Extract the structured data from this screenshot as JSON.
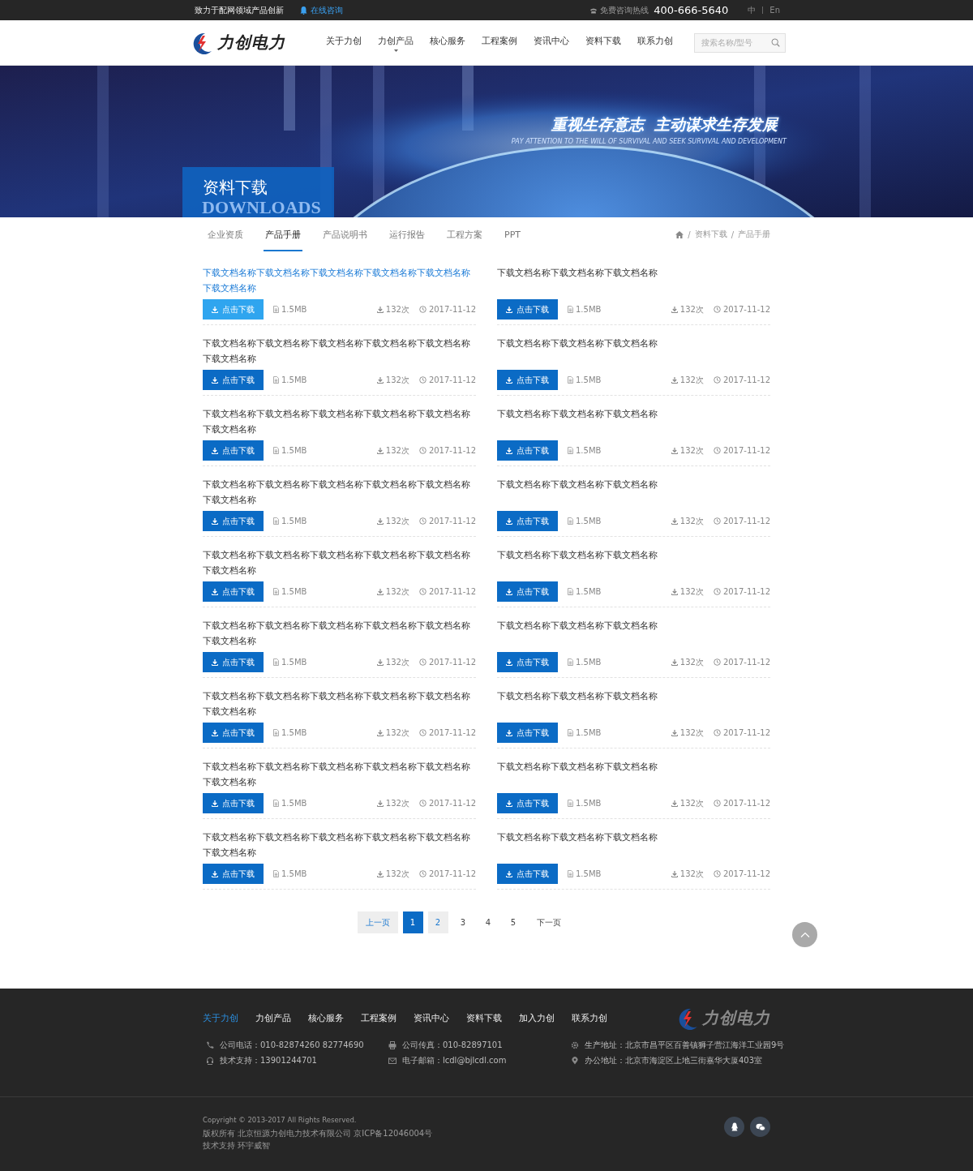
{
  "top_bar": {
    "slogan": "致力于配网领域产品创新",
    "consult_link": "在线咨询",
    "hotline_label": "免费咨询热线",
    "hotline": "400-666-5640",
    "languages": [
      "中",
      "En"
    ]
  },
  "header": {
    "logo_text": "力创电力",
    "nav": [
      {
        "label": "关于力创",
        "dropdown": false
      },
      {
        "label": "力创产品",
        "dropdown": true
      },
      {
        "label": "核心服务",
        "dropdown": false
      },
      {
        "label": "工程案例",
        "dropdown": false
      },
      {
        "label": "资讯中心",
        "dropdown": false
      },
      {
        "label": "资料下载",
        "dropdown": false
      },
      {
        "label": "联系力创",
        "dropdown": false
      }
    ],
    "search": {
      "placeholder": "搜索名称/型号"
    }
  },
  "banner": {
    "kind": "picture",
    "slogan": "重视生存意志  主动谋求生存发展",
    "slogan_en": "PAY ATTENTION TO THE WILL OF SURVIVAL AND SEEK SURVIVAL AND DEVELOPMENT",
    "section_title": "资料下载",
    "section_title_en": "DOWNLOADS"
  },
  "tabs": [
    {
      "label": "企业资质",
      "selected": false
    },
    {
      "label": "产品手册",
      "selected": true
    },
    {
      "label": "产品说明书",
      "selected": false
    },
    {
      "label": "运行报告",
      "selected": false
    },
    {
      "label": "工程方案",
      "selected": false
    },
    {
      "label": "PPT",
      "selected": false
    }
  ],
  "breadcrumb": [
    {
      "separator": "/",
      "label": "资料下载"
    },
    {
      "separator": "/",
      "label": "产品手册"
    }
  ],
  "documents": [
    {
      "title": "下载文档名称下载文档名称下载文档名称下载文档名称下载文档名称下载文档名称",
      "hovered": true,
      "button": "点击下载",
      "size": "1.5MB",
      "downloads": "132次",
      "date": "2017-11-12"
    },
    {
      "title": "下载文档名称下载文档名称下载文档名称",
      "hovered": false,
      "button": "点击下载",
      "size": "1.5MB",
      "downloads": "132次",
      "date": "2017-11-12"
    },
    {
      "title": "下载文档名称下载文档名称下载文档名称下载文档名称下载文档名称下载文档名称",
      "hovered": false,
      "button": "点击下载",
      "size": "1.5MB",
      "downloads": "132次",
      "date": "2017-11-12"
    },
    {
      "title": "下载文档名称下载文档名称下载文档名称",
      "hovered": false,
      "button": "点击下载",
      "size": "1.5MB",
      "downloads": "132次",
      "date": "2017-11-12"
    },
    {
      "title": "下载文档名称下载文档名称下载文档名称下载文档名称下载文档名称下载文档名称",
      "hovered": false,
      "button": "点击下载",
      "size": "1.5MB",
      "downloads": "132次",
      "date": "2017-11-12"
    },
    {
      "title": "下载文档名称下载文档名称下载文档名称",
      "hovered": false,
      "button": "点击下载",
      "size": "1.5MB",
      "downloads": "132次",
      "date": "2017-11-12"
    },
    {
      "title": "下载文档名称下载文档名称下载文档名称下载文档名称下载文档名称下载文档名称",
      "hovered": false,
      "button": "点击下载",
      "size": "1.5MB",
      "downloads": "132次",
      "date": "2017-11-12"
    },
    {
      "title": "下载文档名称下载文档名称下载文档名称",
      "hovered": false,
      "button": "点击下载",
      "size": "1.5MB",
      "downloads": "132次",
      "date": "2017-11-12"
    },
    {
      "title": "下载文档名称下载文档名称下载文档名称下载文档名称下载文档名称下载文档名称",
      "hovered": false,
      "button": "点击下载",
      "size": "1.5MB",
      "downloads": "132次",
      "date": "2017-11-12"
    },
    {
      "title": "下载文档名称下载文档名称下载文档名称",
      "hovered": false,
      "button": "点击下载",
      "size": "1.5MB",
      "downloads": "132次",
      "date": "2017-11-12"
    },
    {
      "title": "下载文档名称下载文档名称下载文档名称下载文档名称下载文档名称下载文档名称",
      "hovered": false,
      "button": "点击下载",
      "size": "1.5MB",
      "downloads": "132次",
      "date": "2017-11-12"
    },
    {
      "title": "下载文档名称下载文档名称下载文档名称",
      "hovered": false,
      "button": "点击下载",
      "size": "1.5MB",
      "downloads": "132次",
      "date": "2017-11-12"
    },
    {
      "title": "下载文档名称下载文档名称下载文档名称下载文档名称下载文档名称下载文档名称",
      "hovered": false,
      "button": "点击下载",
      "size": "1.5MB",
      "downloads": "132次",
      "date": "2017-11-12"
    },
    {
      "title": "下载文档名称下载文档名称下载文档名称",
      "hovered": false,
      "button": "点击下载",
      "size": "1.5MB",
      "downloads": "132次",
      "date": "2017-11-12"
    },
    {
      "title": "下载文档名称下载文档名称下载文档名称下载文档名称下载文档名称下载文档名称",
      "hovered": false,
      "button": "点击下载",
      "size": "1.5MB",
      "downloads": "132次",
      "date": "2017-11-12"
    },
    {
      "title": "下载文档名称下载文档名称下载文档名称",
      "hovered": false,
      "button": "点击下载",
      "size": "1.5MB",
      "downloads": "132次",
      "date": "2017-11-12"
    },
    {
      "title": "下载文档名称下载文档名称下载文档名称下载文档名称下载文档名称下载文档名称",
      "hovered": false,
      "button": "点击下载",
      "size": "1.5MB",
      "downloads": "132次",
      "date": "2017-11-12"
    },
    {
      "title": "下载文档名称下载文档名称下载文档名称",
      "hovered": false,
      "button": "点击下载",
      "size": "1.5MB",
      "downloads": "132次",
      "date": "2017-11-12"
    }
  ],
  "pagination": [
    {
      "kind": "prev",
      "label": "上一页",
      "selected": false,
      "hovered": true
    },
    {
      "kind": "page",
      "label": "1",
      "selected": true,
      "hovered": false
    },
    {
      "kind": "page",
      "label": "2",
      "selected": false,
      "hovered": true
    },
    {
      "kind": "page",
      "label": "3",
      "selected": false,
      "hovered": false
    },
    {
      "kind": "page",
      "label": "4",
      "selected": false,
      "hovered": false
    },
    {
      "kind": "page",
      "label": "5",
      "selected": false,
      "hovered": false
    },
    {
      "kind": "next",
      "label": "下一页",
      "selected": false,
      "hovered": false
    }
  ],
  "footer": {
    "nav": [
      {
        "label": "关于力创",
        "selected": true
      },
      {
        "label": "力创产品",
        "selected": false
      },
      {
        "label": "核心服务",
        "selected": false
      },
      {
        "label": "工程案例",
        "selected": false
      },
      {
        "label": "资讯中心",
        "selected": false
      },
      {
        "label": "资料下载",
        "selected": false
      },
      {
        "label": "加入力创",
        "selected": false
      },
      {
        "label": "联系力创",
        "selected": false
      }
    ],
    "logo_text": "力创电力",
    "contacts": [
      {
        "kind": "phone",
        "text": "公司电话：010-82874260 82774690"
      },
      {
        "kind": "fax",
        "text": "公司传真：010-82897101"
      },
      {
        "kind": "factory",
        "text": "生产地址：北京市昌平区百善镇狮子营江海洋工业园9号"
      },
      {
        "kind": "support",
        "text": "技术支持：13901244701"
      },
      {
        "kind": "email",
        "text": "电子邮箱：lcdl@bjlcdl.com"
      },
      {
        "kind": "office",
        "text": "办公地址：北京市海淀区上地三街嘉华大厦403室"
      }
    ],
    "copyright": [
      "Copyright © 2013-2017 All Rights Reserved.",
      "版权所有 北京恒源力创电力技术有限公司 京ICP备12046004号",
      "技术支持 环宇威智"
    ]
  }
}
